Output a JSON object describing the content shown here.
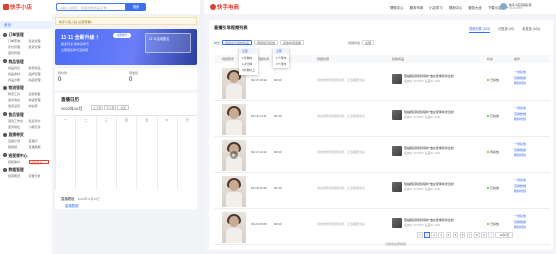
{
  "left": {
    "logo": "快手小店",
    "search_placeholder": "请输入关键字，搜索功能/商品/订单…",
    "search_button": "搜索",
    "home": "首页",
    "sidebar_groups": [
      {
        "title": "订单管理",
        "items": [
          "订单查询",
          "售后管理",
          "评价管理",
          "发货管理",
          "退款管理",
          ""
        ]
      },
      {
        "title": "商品管理",
        "items": [
          "商品列表",
          "新增商品",
          "商品素材",
          "品牌管理",
          "商品诊断",
          "商品管理"
        ]
      },
      {
        "title": "物流管理",
        "items": [
          "物流工具",
          "运费模板",
          "发货地址",
          "快递管理",
          "发货设置",
          "地址库"
        ]
      },
      {
        "title": "售后管理",
        "items": [
          "退款工作台",
          "售后评价",
          "退货地址",
          "小额打款"
        ]
      },
      {
        "title": "直播带货",
        "items": [
          "直播计划",
          "直播间",
          "短视频",
          "直播数据"
        ]
      },
      {
        "title": "短视频中心",
        "items": [
          "视频素材",
          "视频挂车"
        ]
      },
      {
        "title": "数据管理",
        "items": [
          "经营概况",
          "流量分析"
        ]
      }
    ],
    "notice": "快手小店入驻 [立即查看]",
    "promo": {
      "title": "11·11 全新升级 ！",
      "sub1": "超多玩法 等你来参与",
      "sub2": "立即报名参与活动吧",
      "pill": "立即参与",
      "card": "11·11活动报名"
    },
    "stats": [
      {
        "label": "待付款",
        "value": "0"
      },
      {
        "label": "待发货",
        "value": "0"
      }
    ],
    "live": {
      "title": "直播日历",
      "date": "2022年10月",
      "buttons": [
        "上个月",
        "下个月",
        "今天"
      ],
      "weekdays": [
        "一",
        "二",
        "三",
        "四",
        "五",
        "六",
        "日"
      ],
      "footer": "直播看板",
      "footer_sub": "2022年10月19日",
      "tab": "直播数据"
    }
  },
  "right": {
    "logo": "快手电商",
    "nav": [
      "帮助中心",
      "服务市场",
      "小店学习",
      "规则中心",
      "服务大全",
      "下载小店APP"
    ],
    "user": {
      "name": "快手小店店铺名称",
      "id": "ID:1234567"
    },
    "title": "直播引导视频列表",
    "tabs": [
      "视频列表 (183)",
      "已投放 (20)",
      "未投放 (163)"
    ],
    "filter": {
      "label1": "时长",
      "sel1": "视频最近发布时间",
      "sel2": "视频最近投放",
      "sel3": "投放时间选择",
      "label2": "视频状态",
      "sel4": "全部"
    },
    "dropdown1": [
      "全部",
      "1分钟内",
      "1-3分钟",
      "3分钟以上"
    ],
    "dropdown2": [
      "全部",
      "1个月内",
      "2个月内"
    ],
    "columns": [
      "视频预览",
      "直播开始时间",
      "投放时长",
      "视频标题",
      "投放商品",
      "状态",
      "操作"
    ],
    "rows": [
      {
        "start": "09.15 10:32",
        "dur": "00:30",
        "status": "已投放",
        "product": "短袖圆领纯色纯棉T恤女夏季新款宽松",
        "sub": "投放ID: 127165 / 商品ID: 1231",
        "ops": [
          "一键投放",
          "查看数据",
          "删除视频"
        ],
        "play": false
      },
      {
        "start": "09.16 14:11",
        "dur": "00:30",
        "status": "已投放",
        "product": "短袖圆领纯色纯棉T恤女夏季新款宽松",
        "sub": "投放ID: 127165 / 商品ID: 1231",
        "ops": [
          "一键投放",
          "查看数据",
          "删除视频"
        ],
        "play": false
      },
      {
        "start": "09.16 14:11",
        "dur": "00:30",
        "status": "待投放",
        "product": "短袖圆领纯色纯棉T恤女夏季新款宽松",
        "sub": "投放ID: 127165 / 商品ID: 1231",
        "ops": [
          "一键投放",
          "查看数据",
          "删除视频"
        ],
        "play": true
      },
      {
        "start": "09.18 19:42",
        "dur": "00:30",
        "status": "已投放",
        "product": "短袖圆领纯色纯棉T恤女夏季新款宽松",
        "sub": "投放ID: 127165 / 商品ID: 1231",
        "ops": [
          "一键投放",
          "查看数据",
          "删除视频"
        ],
        "play": false
      },
      {
        "start": "09.20 20:05",
        "dur": "00:30",
        "status": "已投放",
        "product": "短袖圆领纯色纯棉T恤女夏季新款宽松",
        "sub": "投放ID: 127165 / 商品ID: 1231",
        "ops": [
          "一键投放",
          "查看数据",
          "删除视频"
        ],
        "play": false
      }
    ],
    "edit_hint": "添加或修改视频标题，让直播更出彩",
    "note": "已加载全部视频",
    "pager": [
      "<",
      "1",
      "2",
      "3",
      "4",
      "5",
      "6",
      "7",
      "8",
      "9",
      ">",
      "10条/页"
    ]
  },
  "colors": {
    "accent": "#3a6ff0",
    "brand": "#e63e30",
    "promo": "#4b6cf5"
  }
}
